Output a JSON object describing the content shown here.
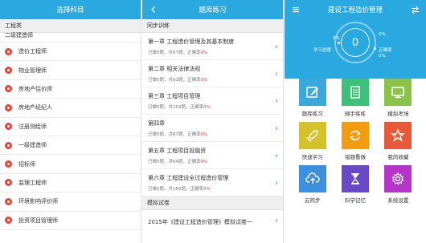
{
  "panel1": {
    "title": "选择科目",
    "section": "工程类",
    "partial_item": "二级建造师",
    "subjects": [
      "造价工程师",
      "物业管理师",
      "房地产估价师",
      "房地产经纪人",
      "注册测绘师",
      "一级建造师",
      "招标师",
      "监理工程师",
      "环境影响评价师",
      "投资项目管理师"
    ],
    "dot_color": "#e2473b"
  },
  "panel2": {
    "title": "题库练习",
    "back_icon": "chevron-left-icon",
    "section_sync": "同步训练",
    "chapters": [
      {
        "title": "第一章  工程造价管理及其基本制度",
        "done": "已做0题，共87题，正确率",
        "rate": "0%"
      },
      {
        "title": "第二章  相关法律法规",
        "done": "已做0题，共93题，正确率",
        "rate": "0%"
      },
      {
        "title": "第三章  工程项目管理",
        "done": "已做0题，共103题，正确率",
        "rate": "0%"
      },
      {
        "title": "第四章  ",
        "done": "已做0题，共87题，正确率",
        "rate": "0%"
      },
      {
        "title": "第五章  工程项目投融资",
        "done": "已做0题，共64题，正确率",
        "rate": "0%"
      },
      {
        "title": "第六章  工程建设全过程造价管理",
        "done": "已做0题，共156题，正确率",
        "rate": "0%"
      }
    ],
    "section_mock": "模拟试卷",
    "exam_title": "2015年《建设工程造价管理》模拟试卷一"
  },
  "panel3": {
    "title": "建设工程造价管理",
    "menu_icon": "menu-icon",
    "swap_icon": "swap-icon",
    "progress_center": "0",
    "progress_label": "学习进度",
    "progress_pct": "0%",
    "accuracy_label": "正确率",
    "accuracy_pct_top": "0%",
    "accuracy_pct_bottom": "0%",
    "tiles": [
      {
        "label": "题库练习",
        "color": "#3aa9d9",
        "icon": "pencil-icon"
      },
      {
        "label": "随手练练",
        "color": "#3ec07a",
        "icon": "document-icon"
      },
      {
        "label": "模拟考场",
        "color": "#8bc34a",
        "icon": "monitor-icon"
      },
      {
        "label": "快速学习",
        "color": "#d4c22b",
        "icon": "rocket-icon"
      },
      {
        "label": "错题重做",
        "color": "#f39c12",
        "icon": "refresh-icon"
      },
      {
        "label": "我的收藏",
        "color": "#e8593a",
        "icon": "star-icon"
      },
      {
        "label": "云同步",
        "color": "#3d8fe0",
        "icon": "cloud-upload-icon"
      },
      {
        "label": "科学记忆",
        "color": "#6b48c8",
        "icon": "hourglass-icon"
      },
      {
        "label": "系统设置",
        "color": "#b535c9",
        "icon": "gear-icon"
      }
    ]
  }
}
